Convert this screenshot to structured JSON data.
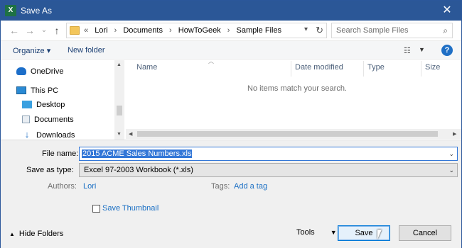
{
  "window": {
    "title": "Save As",
    "app_icon_letter": "X",
    "close_glyph": "✕"
  },
  "nav": {
    "back_glyph": "←",
    "forward_glyph": "→",
    "recent_glyph": "⌄",
    "up_glyph": "↑"
  },
  "address": {
    "overflow": "«",
    "crumbs": [
      "Lori",
      "Documents",
      "HowToGeek",
      "Sample Files"
    ],
    "separator": "›"
  },
  "search": {
    "placeholder": "Search Sample Files"
  },
  "toolbar": {
    "organize": "Organize ▾",
    "new_folder": "New folder",
    "help": "?"
  },
  "sidebar": {
    "items": [
      {
        "label": "OneDrive",
        "icon": "cloud-icon"
      },
      {
        "label": "This PC",
        "icon": "computer-icon"
      },
      {
        "label": "Desktop",
        "icon": "desktop-icon"
      },
      {
        "label": "Documents",
        "icon": "documents-icon"
      },
      {
        "label": "Downloads",
        "icon": "download-icon"
      }
    ]
  },
  "filelist": {
    "columns": [
      "Name",
      "Date modified",
      "Type",
      "Size"
    ],
    "empty_message": "No items match your search."
  },
  "form": {
    "file_name_label": "File name:",
    "file_name_value": "2015 ACME Sales Numbers.xls",
    "save_type_label": "Save as type:",
    "save_type_value": "Excel 97-2003 Workbook (*.xls)",
    "authors_label": "Authors:",
    "authors_value": "Lori",
    "tags_label": "Tags:",
    "tags_value": "Add a tag",
    "thumbnail_label": "Save Thumbnail",
    "thumbnail_checked": false
  },
  "footer": {
    "hide_folders": "Hide Folders",
    "tools": "Tools",
    "save": "Save",
    "cancel": "Cancel"
  },
  "colors": {
    "titlebar": "#2b5797",
    "link": "#1a6fc4",
    "selection": "#3377d7"
  }
}
